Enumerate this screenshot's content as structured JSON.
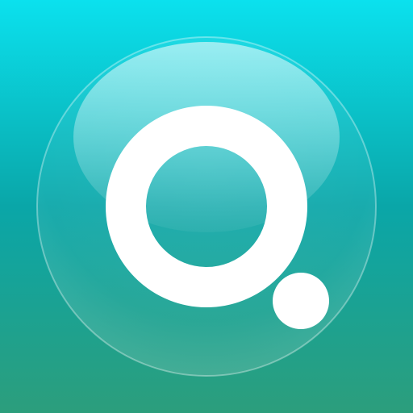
{
  "app_icon": {
    "icon": "ring-with-dot-logo-icon",
    "colors": {
      "background_top": "#0BE1EE",
      "background_middle": "#0AA6A8",
      "background_bottom": "#2C9E7C",
      "glass_bubble": "#FFFFFF",
      "ring": "#FFFFFF",
      "dot": "#FFFFFF"
    }
  }
}
